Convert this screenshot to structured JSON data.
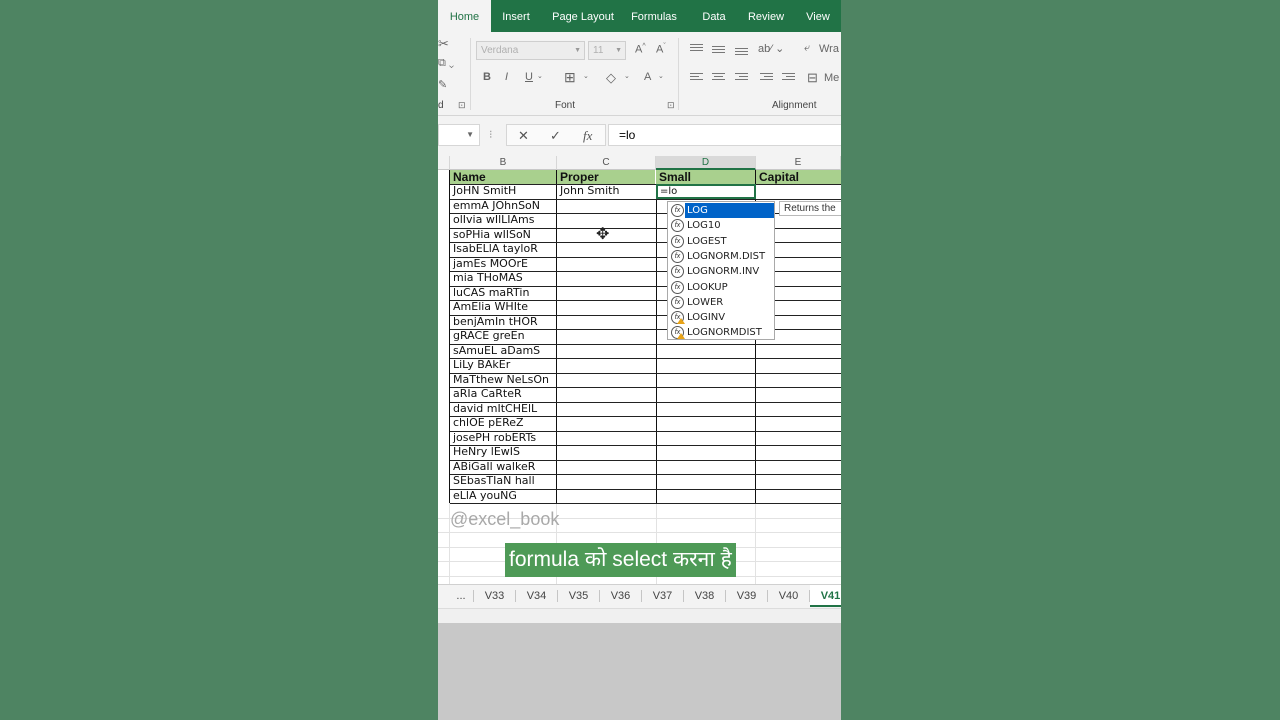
{
  "ribbon": {
    "tabs": [
      "Home",
      "Insert",
      "Page Layout",
      "Formulas",
      "Data",
      "Review",
      "View"
    ],
    "active_tab": "Home",
    "font_name": "Verdana",
    "font_size": "11",
    "bold": "B",
    "italic": "I",
    "underline": "U",
    "font_color_glyph": "A",
    "wrap_label": "Wra",
    "merge_label": "Me",
    "group_font": "Font",
    "group_alignment": "Alignment"
  },
  "formula_bar": {
    "cancel": "✕",
    "enter": "✓",
    "fx": "fx",
    "value": "=lo"
  },
  "grid": {
    "columns": [
      "B",
      "C",
      "D",
      "E"
    ],
    "selected_column": "D",
    "headers": [
      "Name",
      "Proper",
      "Small",
      "Capital"
    ],
    "names": [
      "JoHN SmitH",
      "emmA JOhnSoN",
      "olIvia wIlLIAms",
      "soPHia wIlSoN",
      "IsabELlA tayloR",
      "jamEs MOOrE",
      "mia THoMAS",
      "luCAS maRTin",
      "AmElia WHIte",
      "benjAmIn tHOR",
      "gRACE greEn",
      "sAmuEL aDamS",
      "LiLy BAkEr",
      "MaTthew NeLsOn",
      "aRIa CaRteR",
      "david mItCHElL",
      "chlOE pEReZ",
      "josePH robERTs",
      "HeNry lEwIS",
      "ABiGaIl walkeR",
      "SEbasTIaN hall",
      "eLlA youNG"
    ],
    "proper_first": "John Smith",
    "active_cell_value": "=lo"
  },
  "autocomplete": {
    "items": [
      {
        "name": "LOG",
        "warn": false
      },
      {
        "name": "LOG10",
        "warn": false
      },
      {
        "name": "LOGEST",
        "warn": false
      },
      {
        "name": "LOGNORM.DIST",
        "warn": false
      },
      {
        "name": "LOGNORM.INV",
        "warn": false
      },
      {
        "name": "LOOKUP",
        "warn": false
      },
      {
        "name": "LOWER",
        "warn": false
      },
      {
        "name": "LOGINV",
        "warn": true
      },
      {
        "name": "LOGNORMDIST",
        "warn": true
      }
    ],
    "selected": "LOG",
    "tooltip": "Returns the"
  },
  "watermark": "@excel_book",
  "caption": "formula को select करना है",
  "sheets": {
    "more": "...",
    "tabs": [
      "V33",
      "V34",
      "V35",
      "V36",
      "V37",
      "V38",
      "V39",
      "V40",
      "V41"
    ],
    "active": "V41"
  },
  "colors": {
    "background": "#4e8462",
    "excel_green": "#217346",
    "header_fill": "#a9d08e",
    "selection_blue": "#0063c8"
  }
}
